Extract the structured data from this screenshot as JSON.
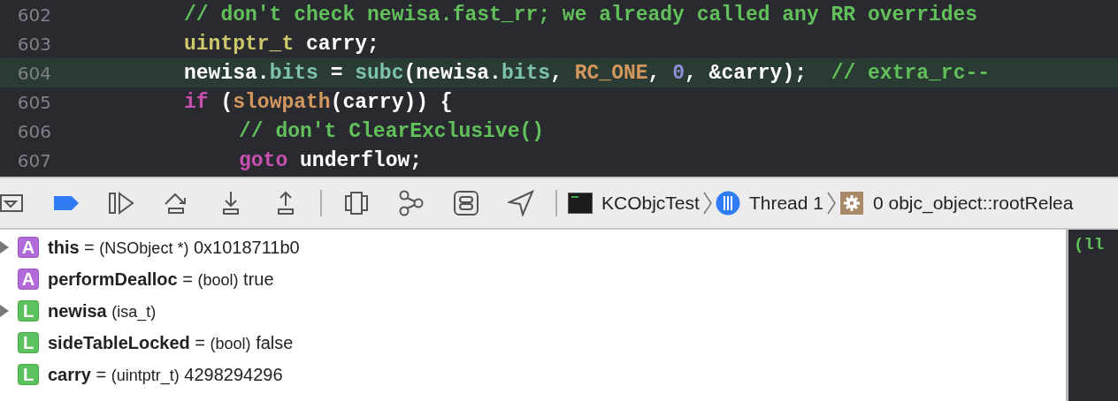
{
  "editor": {
    "lines": [
      {
        "number": "602",
        "highlighted": false,
        "tokens": [
          {
            "kind": "comment",
            "text": "// don't check newisa.fast_rr; we already called any RR overrides"
          }
        ]
      },
      {
        "number": "603",
        "highlighted": false,
        "tokens": [
          {
            "kind": "type",
            "text": "uintptr_t"
          },
          {
            "kind": "plain",
            "text": " carry;"
          }
        ]
      },
      {
        "number": "604",
        "highlighted": true,
        "tokens": [
          {
            "kind": "plain",
            "text": "newisa."
          },
          {
            "kind": "property",
            "text": "bits"
          },
          {
            "kind": "plain",
            "text": " = "
          },
          {
            "kind": "function",
            "text": "subc"
          },
          {
            "kind": "plain",
            "text": "(newisa."
          },
          {
            "kind": "property",
            "text": "bits"
          },
          {
            "kind": "plain",
            "text": ", "
          },
          {
            "kind": "macro",
            "text": "RC_ONE"
          },
          {
            "kind": "plain",
            "text": ", "
          },
          {
            "kind": "number",
            "text": "0"
          },
          {
            "kind": "plain",
            "text": ", &carry);  "
          },
          {
            "kind": "comment",
            "text": "// extra_rc--"
          }
        ]
      },
      {
        "number": "605",
        "highlighted": false,
        "tokens": [
          {
            "kind": "keyword",
            "text": "if"
          },
          {
            "kind": "plain",
            "text": " ("
          },
          {
            "kind": "macro",
            "text": "slowpath"
          },
          {
            "kind": "plain",
            "text": "(carry)) {"
          }
        ],
        "children": [
          {
            "number": "606",
            "highlighted": false,
            "tokens": [
              {
                "kind": "comment",
                "text": "// don't ClearExclusive()"
              }
            ]
          },
          {
            "number": "607",
            "highlighted": false,
            "tokens": [
              {
                "kind": "keyword",
                "text": "goto"
              },
              {
                "kind": "plain",
                "text": " underflow;"
              }
            ]
          }
        ]
      }
    ]
  },
  "debug_bar": {
    "buttons": [
      {
        "kind": "hide-panel"
      },
      {
        "kind": "breakpoints"
      },
      {
        "kind": "continue"
      },
      {
        "kind": "step-over"
      },
      {
        "kind": "step-into"
      },
      {
        "kind": "step-out"
      },
      {
        "kind": "separator"
      },
      {
        "kind": "view-hierarchy"
      },
      {
        "kind": "memory-graph"
      },
      {
        "kind": "environment"
      },
      {
        "kind": "location"
      }
    ],
    "breadcrumb": [
      {
        "kind": "app",
        "label": "KCObjcTest"
      },
      {
        "kind": "thread",
        "label": "Thread 1"
      },
      {
        "kind": "frame",
        "label": "0 objc_object::rootRelea"
      }
    ]
  },
  "variables": [
    {
      "badge": "A",
      "kind": "argument",
      "expandable": true,
      "name": "this",
      "operator": "=",
      "type": "(NSObject *)",
      "value": "0x1018711b0"
    },
    {
      "badge": "A",
      "kind": "argument",
      "expandable": false,
      "name": "performDealloc",
      "operator": "=",
      "type": "(bool)",
      "value": "true"
    },
    {
      "badge": "L",
      "kind": "local",
      "expandable": true,
      "name": "newisa",
      "type": "(isa_t)"
    },
    {
      "badge": "L",
      "kind": "local",
      "expandable": false,
      "name": "sideTableLocked",
      "operator": "=",
      "type": "(bool)",
      "value": "false"
    },
    {
      "badge": "L",
      "kind": "local",
      "expandable": false,
      "name": "carry",
      "operator": "=",
      "type": "(uintptr_t)",
      "value": "4298294296"
    }
  ],
  "console": {
    "text": "(ll"
  }
}
